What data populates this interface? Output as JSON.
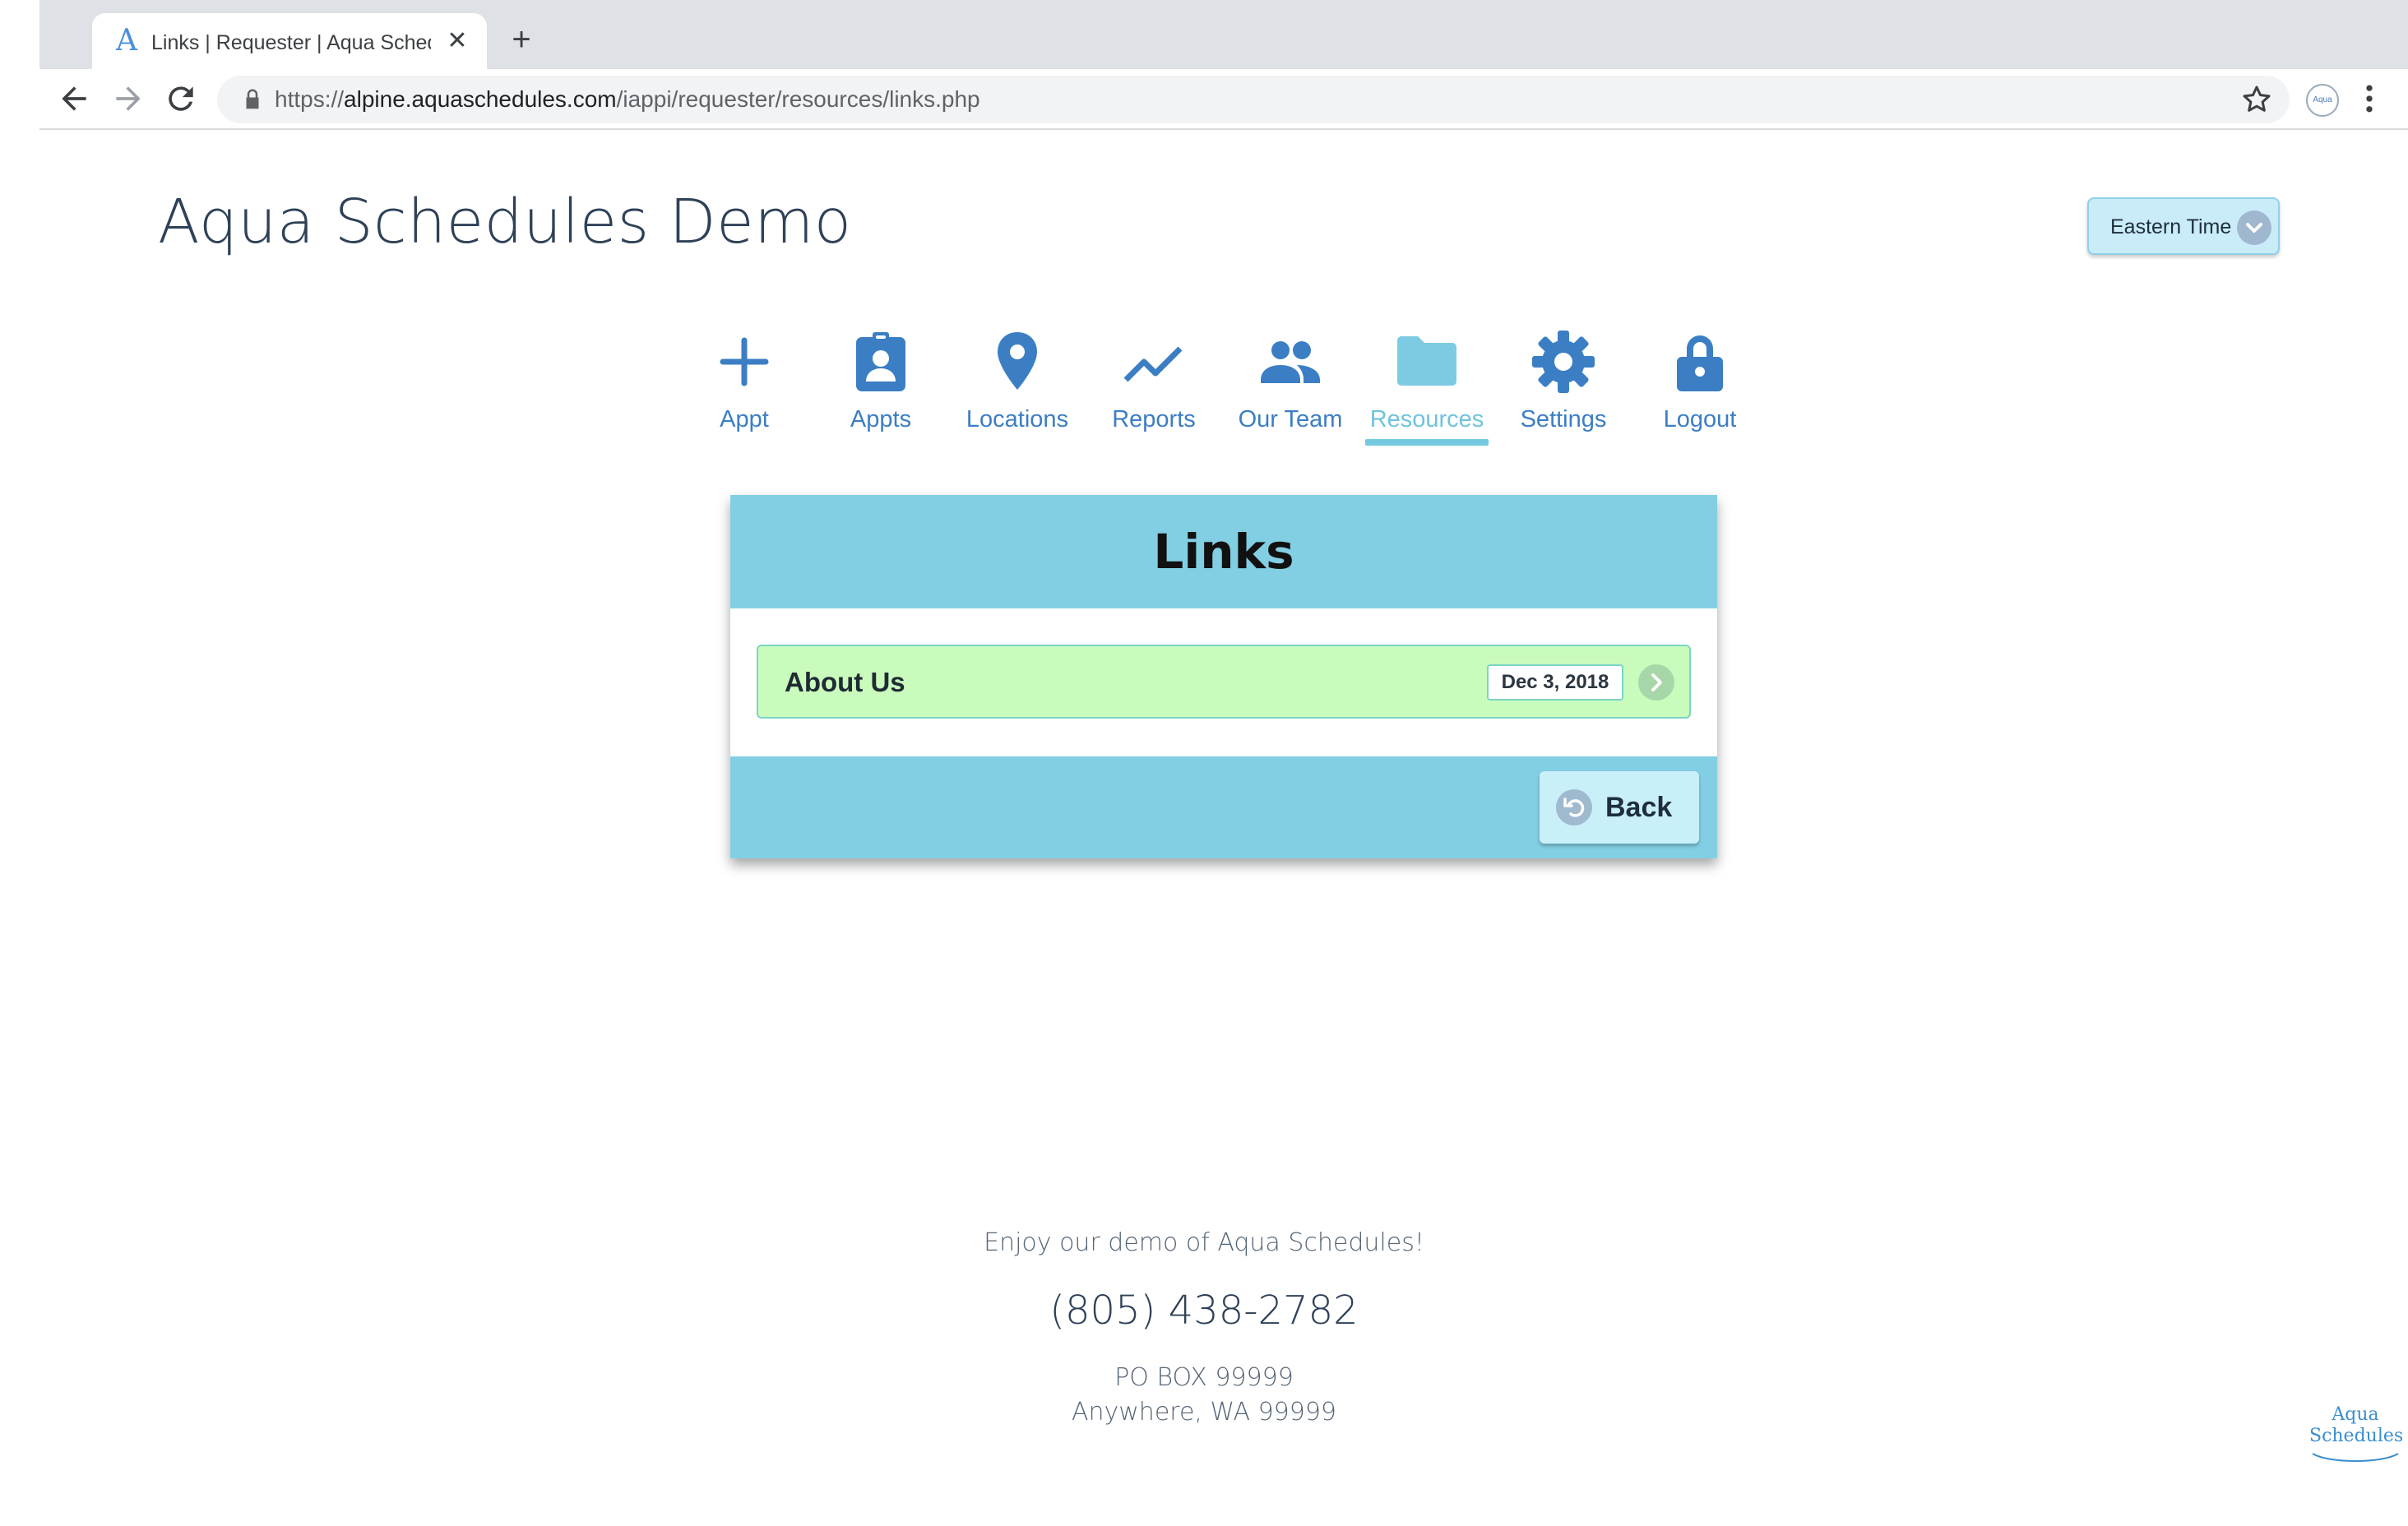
{
  "browser": {
    "tab_title": "Links | Requester | Aqua Schedules",
    "tab_favicon": "A",
    "close_glyph": "✕",
    "new_tab_glyph": "+",
    "url_prefix": "https://",
    "url_host": "alpine.aquaschedules.com",
    "url_path": "/iappi/requester/resources/links.php",
    "extension_label": "Aqua"
  },
  "header": {
    "site_title": "Aqua Schedules Demo",
    "timezone": "Eastern Time"
  },
  "nav": {
    "items": [
      {
        "label": "Appt",
        "icon": "plus-icon"
      },
      {
        "label": "Appts",
        "icon": "badge-icon"
      },
      {
        "label": "Locations",
        "icon": "map-pin-icon"
      },
      {
        "label": "Reports",
        "icon": "trend-icon"
      },
      {
        "label": "Our Team",
        "icon": "people-icon"
      },
      {
        "label": "Resources",
        "icon": "folder-icon",
        "active": true
      },
      {
        "label": "Settings",
        "icon": "gear-icon"
      },
      {
        "label": "Logout",
        "icon": "lock-icon"
      }
    ],
    "icon_color": "#3b7ec4",
    "active_color": "#6fc3dd"
  },
  "panel": {
    "title": "Links",
    "links": [
      {
        "label": "About Us",
        "date": "Dec 3, 2018"
      }
    ],
    "back_label": "Back"
  },
  "footer": {
    "tagline": "Enjoy our demo of Aqua Schedules!",
    "phone": "(805) 438-2782",
    "address_line1": "PO BOX 99999",
    "address_line2": "Anywhere, WA 99999"
  },
  "badge": {
    "line1": "Aqua",
    "line2": "Schedules"
  }
}
